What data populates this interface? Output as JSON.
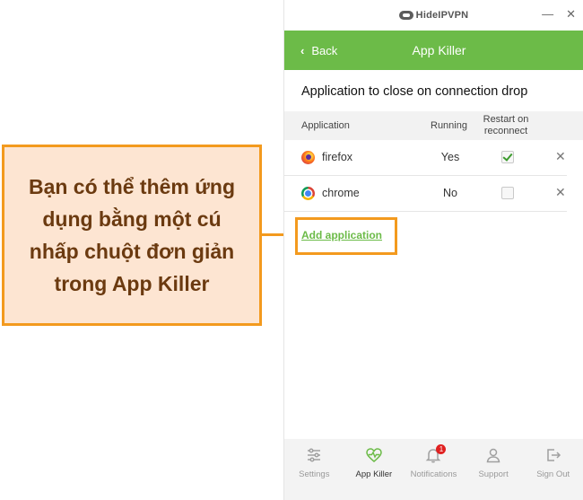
{
  "callout": {
    "text": "Bạn có thể thêm ứng dụng bằng một cú nhấp chuột đơn giản trong App Killer"
  },
  "window": {
    "logo_text": "HideIPVPN",
    "minimize_label": "—",
    "close_label": "✕"
  },
  "header": {
    "back_label": "Back",
    "title": "App Killer",
    "color": "#6cbb48"
  },
  "section": {
    "title": "Application to close on connection drop"
  },
  "table": {
    "headers": {
      "application": "Application",
      "running": "Running",
      "restart": "Restart on reconnect"
    },
    "rows": [
      {
        "name": "firefox",
        "running": "Yes",
        "restart_checked": true,
        "icon": "firefox-icon"
      },
      {
        "name": "chrome",
        "running": "No",
        "restart_checked": false,
        "icon": "chrome-icon"
      }
    ],
    "remove_label": "✕"
  },
  "add_application": {
    "label": "Add application"
  },
  "nav": {
    "items": [
      {
        "label": "Settings",
        "icon": "sliders-icon"
      },
      {
        "label": "App Killer",
        "icon": "heartbeat-icon",
        "active": true
      },
      {
        "label": "Notifications",
        "icon": "bell-icon",
        "badge": "1"
      },
      {
        "label": "Support",
        "icon": "user-icon"
      },
      {
        "label": "Sign Out",
        "icon": "sign-out-icon"
      }
    ]
  },
  "colors": {
    "accent_orange": "#f39a1e",
    "callout_bg": "#fde5d2",
    "callout_text": "#6b3a10"
  }
}
